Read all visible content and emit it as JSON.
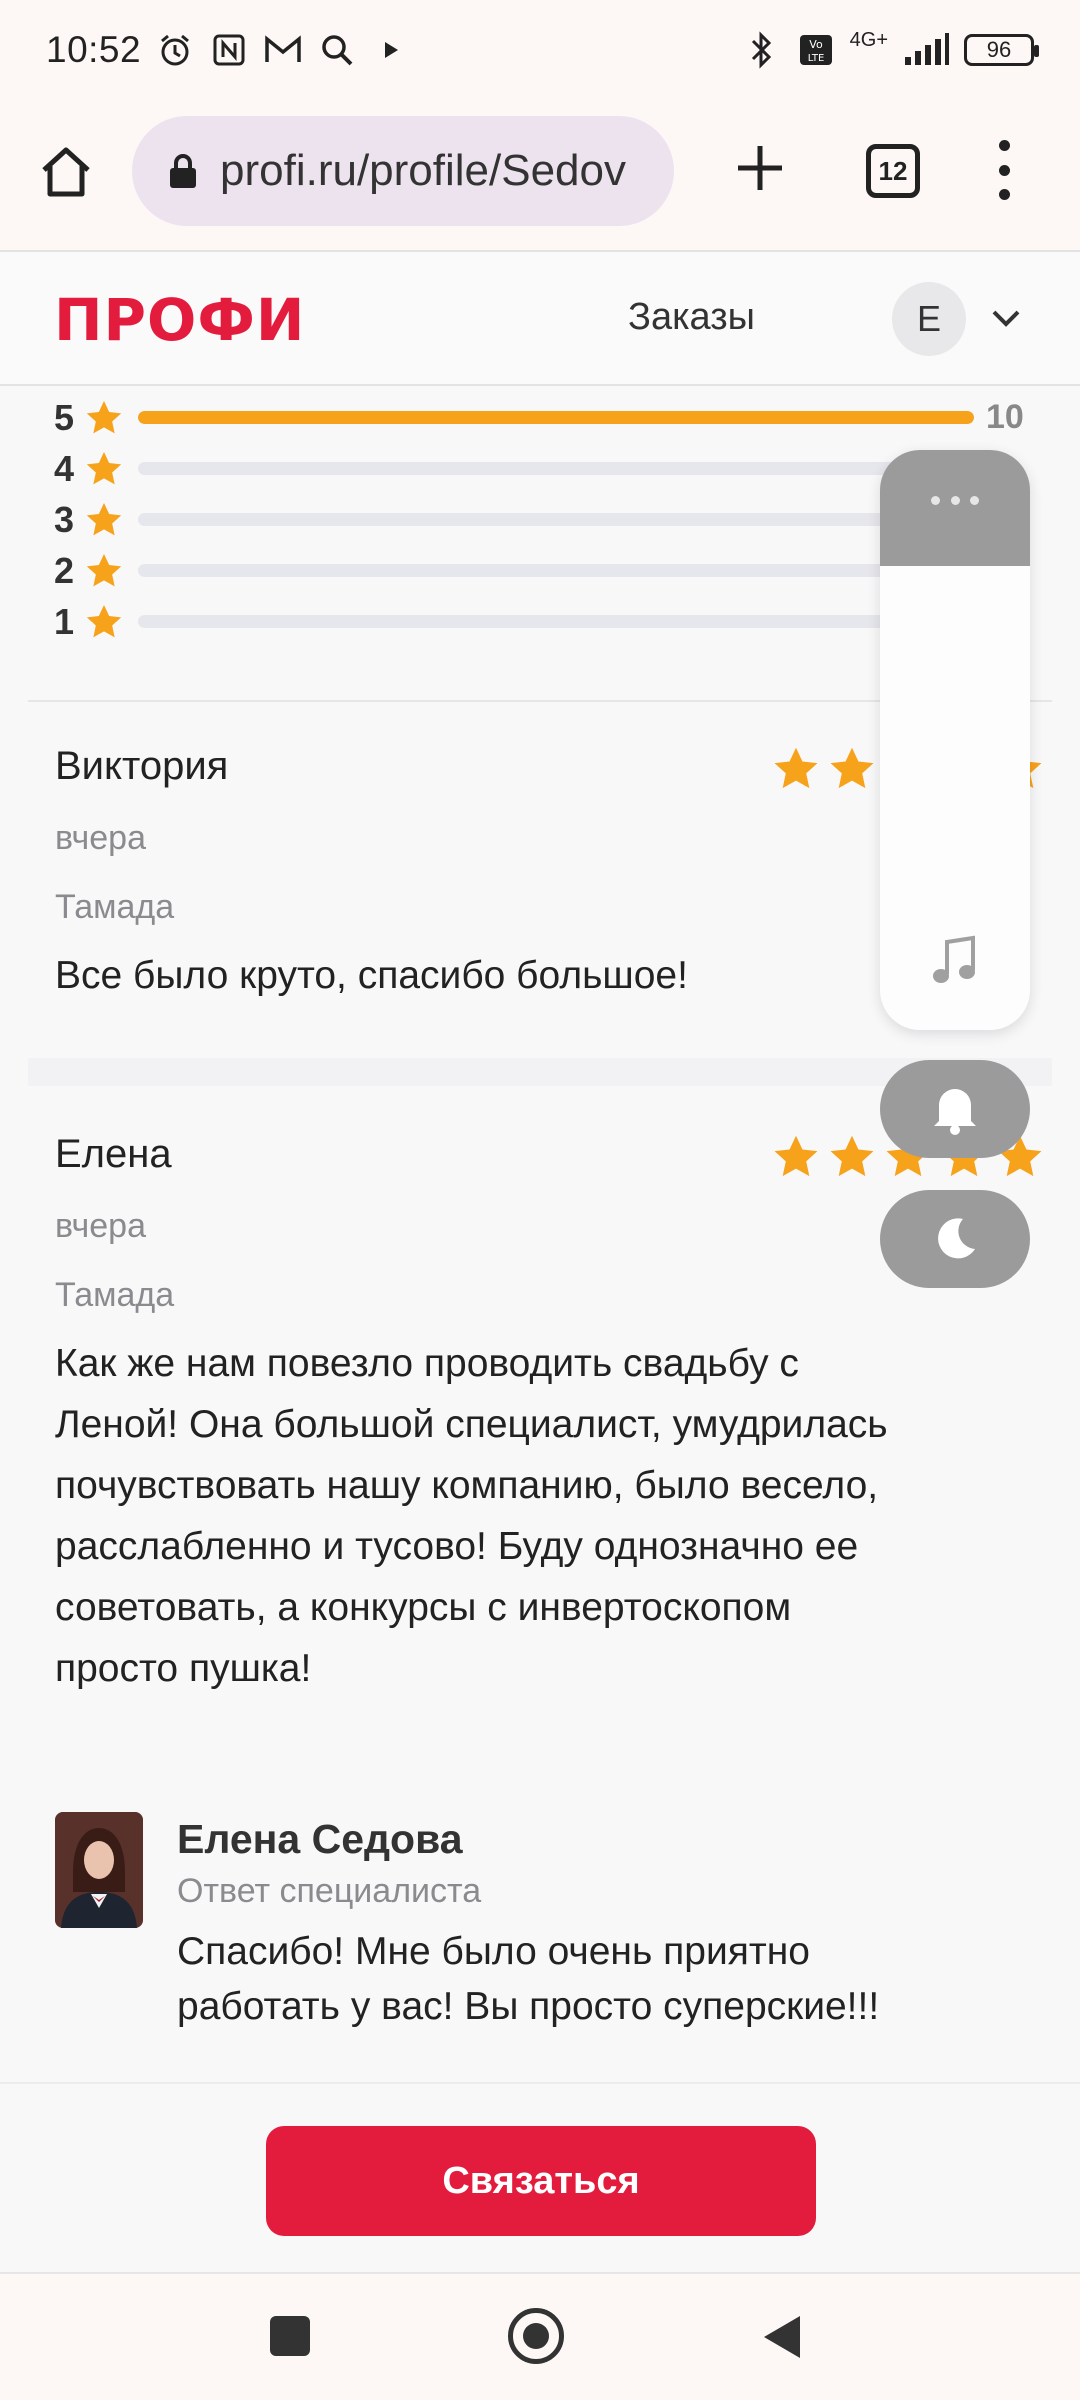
{
  "status_bar": {
    "time": "10:52",
    "network": "4G+",
    "battery": "96"
  },
  "browser": {
    "url": "profi.ru/profile/Sedov",
    "tab_count": "12"
  },
  "header": {
    "logo": "ПРОФИ",
    "orders_label": "Заказы",
    "avatar_initial": "Е"
  },
  "rating_breakdown": [
    {
      "stars": "5",
      "fraction": 1.0,
      "count": "10"
    },
    {
      "stars": "4",
      "fraction": 0.0,
      "count": ""
    },
    {
      "stars": "3",
      "fraction": 0.0,
      "count": ""
    },
    {
      "stars": "2",
      "fraction": 0.0,
      "count": ""
    },
    {
      "stars": "1",
      "fraction": 0.0,
      "count": ""
    }
  ],
  "reviews": [
    {
      "author": "Виктория",
      "date": "вчера",
      "service": "Тамада",
      "rating": 5,
      "text": "Все было круто, спасибо большое!"
    },
    {
      "author": "Елена",
      "date": "вчера",
      "service": "Тамада",
      "rating": 5,
      "text_lines": [
        "Как же нам повезло проводить свадьбу с",
        "Леной! Она большой специалист, умудрилась",
        "почувствовать нашу компанию, было весело,",
        "расслабленно и тусово! Буду однозначно ее",
        "советовать, а конкурсы с инвертоскопом",
        "просто пушка!"
      ]
    }
  ],
  "reply": {
    "name": "Елена Седова",
    "role": "Ответ специалиста",
    "text_lines": [
      "Спасибо! Мне было очень приятно",
      "работать у вас! Вы просто суперские!!!"
    ]
  },
  "action": {
    "contact_label": "Связаться"
  },
  "colors": {
    "brand_red": "#e31c3d",
    "star_orange": "#f7a21b"
  }
}
